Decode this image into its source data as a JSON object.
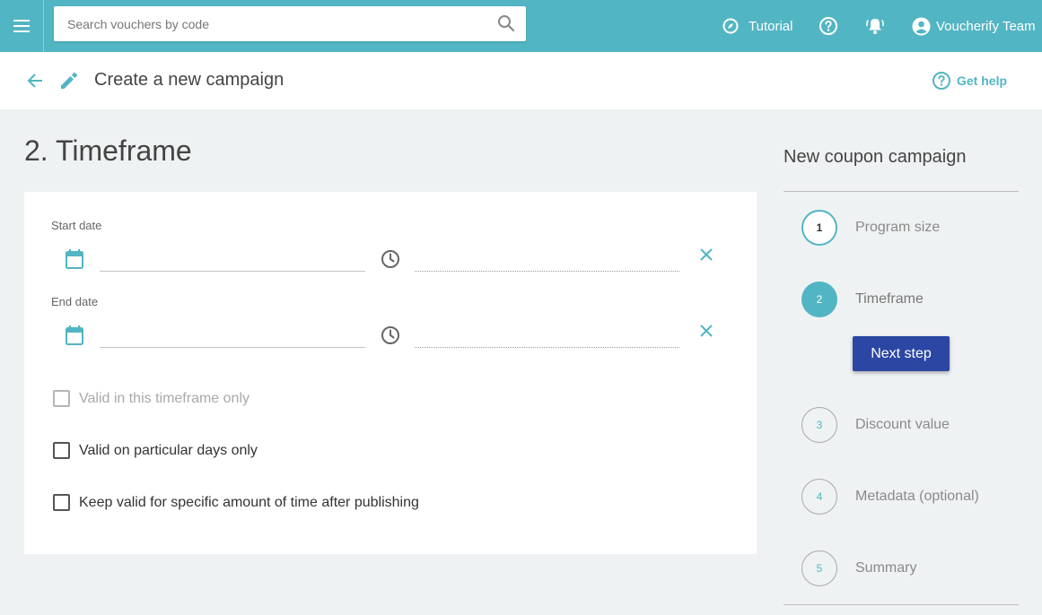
{
  "topbar": {
    "search_placeholder": "Search vouchers by code",
    "tutorial_label": "Tutorial",
    "user_label": "Voucherify Team",
    "brand_color": "#52b5c3"
  },
  "header": {
    "title": "Create a new campaign",
    "get_help_label": "Get help"
  },
  "main": {
    "step_heading": "2. Timeframe",
    "start_date_label": "Start date",
    "end_date_label": "End date",
    "start_date_value": "",
    "start_time_value": "",
    "end_date_value": "",
    "end_time_value": "",
    "options": [
      {
        "label": "Valid in this timeframe only",
        "checked": false,
        "disabled": true
      },
      {
        "label": "Valid on particular days only",
        "checked": false,
        "disabled": false
      },
      {
        "label": "Keep valid for specific amount of time after publishing",
        "checked": false,
        "disabled": false
      }
    ]
  },
  "sidebar": {
    "title": "New coupon campaign",
    "steps": [
      {
        "number": "1",
        "label": "Program size",
        "state": "done"
      },
      {
        "number": "2",
        "label": "Timeframe",
        "state": "active"
      },
      {
        "number": "3",
        "label": "Discount value",
        "state": "pending"
      },
      {
        "number": "4",
        "label": "Metadata (optional)",
        "state": "pending"
      },
      {
        "number": "5",
        "label": "Summary",
        "state": "pending"
      }
    ],
    "next_button_label": "Next step",
    "next_button_color": "#2c47a3"
  }
}
